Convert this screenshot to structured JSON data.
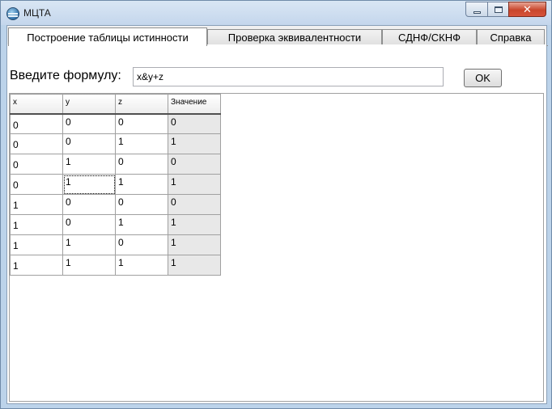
{
  "window": {
    "title": "МЦТА"
  },
  "tabs": [
    {
      "label": "Построение таблицы истинности",
      "active": true
    },
    {
      "label": "Проверка эквивалентности",
      "active": false
    },
    {
      "label": "СДНФ/СКНФ",
      "active": false
    },
    {
      "label": "Справка",
      "active": false
    }
  ],
  "formula": {
    "label": "Введите формулу:",
    "value": "x&y+z"
  },
  "ok_label": "OK",
  "table": {
    "headers": [
      "x",
      "y",
      "z",
      "Значение"
    ],
    "rows": [
      [
        "0",
        "0",
        "0",
        "0"
      ],
      [
        "0",
        "0",
        "1",
        "1"
      ],
      [
        "0",
        "1",
        "0",
        "0"
      ],
      [
        "0",
        "1",
        "1",
        "1"
      ],
      [
        "1",
        "0",
        "0",
        "0"
      ],
      [
        "1",
        "0",
        "1",
        "1"
      ],
      [
        "1",
        "1",
        "0",
        "1"
      ],
      [
        "1",
        "1",
        "1",
        "1"
      ]
    ]
  },
  "colors": {
    "result_column": "#e8e8e8",
    "close_button": "#c9462c"
  }
}
